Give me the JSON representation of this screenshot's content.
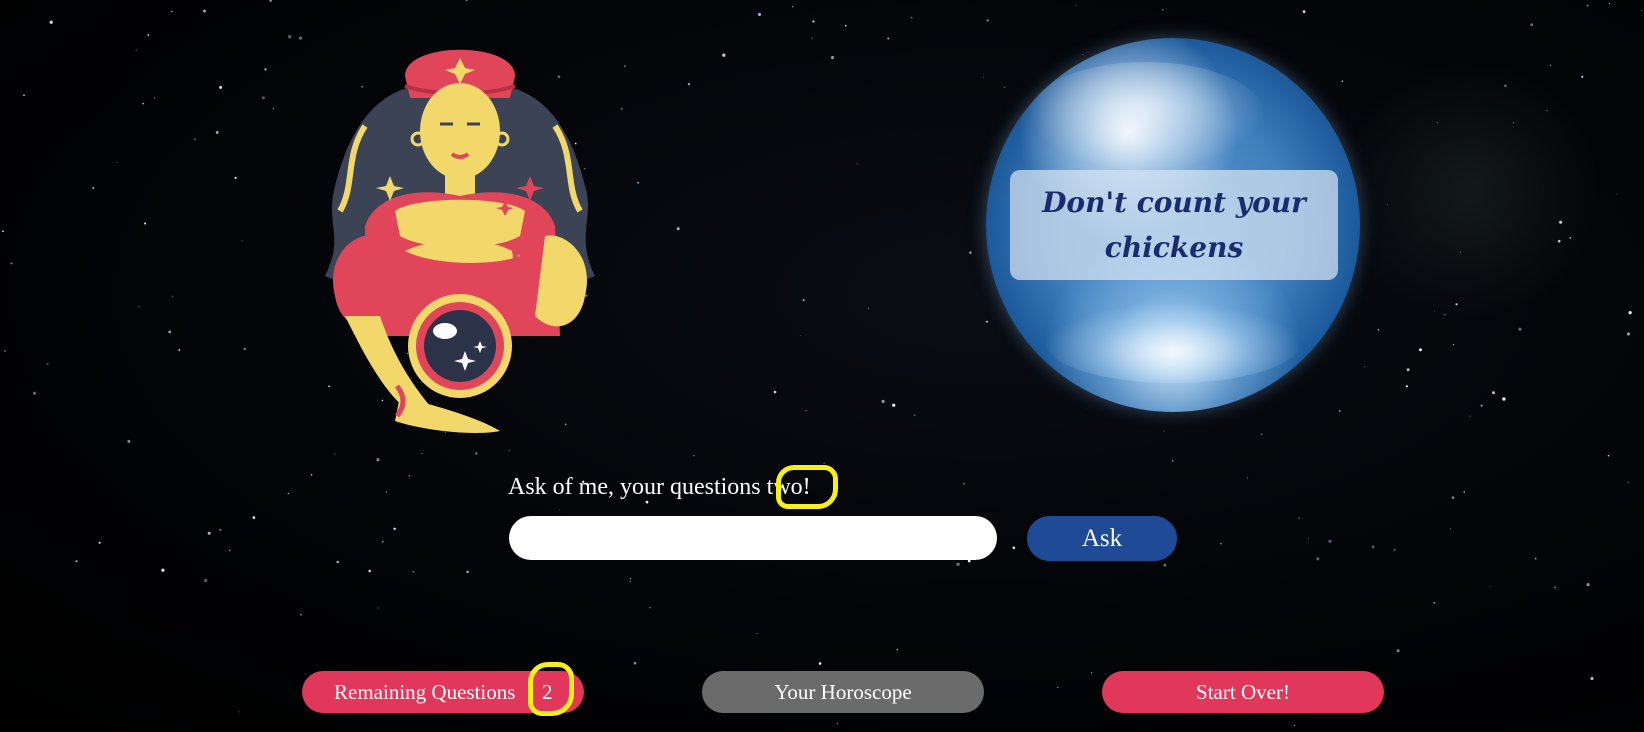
{
  "crystal_ball": {
    "fortune": "Don't count your chickens"
  },
  "question": {
    "prompt": "Ask of me, your questions two!",
    "input_value": "",
    "input_placeholder": "",
    "ask_label": "Ask"
  },
  "bottom_bar": {
    "remaining_label": "Remaining Questions",
    "remaining_count": "2",
    "horoscope_label": "Your Horoscope",
    "start_over_label": "Start Over!"
  },
  "colors": {
    "ask_button": "#1f4a95",
    "primary_button": "#e0375a",
    "secondary_button": "#6b6b6b",
    "annotation": "#f5f01a",
    "fortune_text": "#1a2b6e"
  },
  "icons": [
    "fortune-teller-illustration",
    "crystal-ball-image"
  ]
}
